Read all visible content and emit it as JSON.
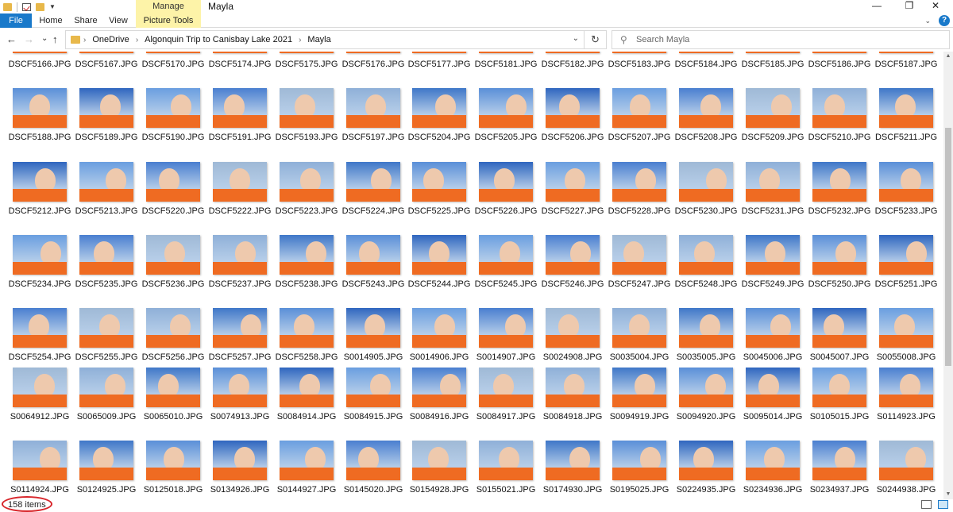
{
  "title_bar": {
    "manage_tab": "Manage",
    "window_title": "Mayla",
    "minimize": "—",
    "maximize": "❐",
    "close": "✕"
  },
  "ribbon": {
    "tabs": [
      "File",
      "Home",
      "Share",
      "View",
      "Picture Tools"
    ],
    "accent_color": "#1979ca",
    "tools_color": "#fdf3a8"
  },
  "nav": {
    "back": "←",
    "forward": "→",
    "recent": "⌄",
    "up": "↑",
    "breadcrumbs": [
      "OneDrive",
      "Algonquin Trip to Canisbay Lake 2021",
      "Mayla"
    ],
    "dropdown": "⌄",
    "refresh": "↻"
  },
  "search": {
    "placeholder": "Search Mayla"
  },
  "files": [
    [
      "DSCF5166.JPG",
      "DSCF5167.JPG",
      "DSCF5170.JPG",
      "DSCF5174.JPG",
      "DSCF5175.JPG",
      "DSCF5176.JPG",
      "DSCF5177.JPG",
      "DSCF5181.JPG",
      "DSCF5182.JPG",
      "DSCF5183.JPG",
      "DSCF5184.JPG",
      "DSCF5185.JPG",
      "DSCF5186.JPG",
      "DSCF5187.JPG"
    ],
    [
      "DSCF5188.JPG",
      "DSCF5189.JPG",
      "DSCF5190.JPG",
      "DSCF5191.JPG",
      "DSCF5193.JPG",
      "DSCF5197.JPG",
      "DSCF5204.JPG",
      "DSCF5205.JPG",
      "DSCF5206.JPG",
      "DSCF5207.JPG",
      "DSCF5208.JPG",
      "DSCF5209.JPG",
      "DSCF5210.JPG",
      "DSCF5211.JPG"
    ],
    [
      "DSCF5212.JPG",
      "DSCF5213.JPG",
      "DSCF5220.JPG",
      "DSCF5222.JPG",
      "DSCF5223.JPG",
      "DSCF5224.JPG",
      "DSCF5225.JPG",
      "DSCF5226.JPG",
      "DSCF5227.JPG",
      "DSCF5228.JPG",
      "DSCF5230.JPG",
      "DSCF5231.JPG",
      "DSCF5232.JPG",
      "DSCF5233.JPG"
    ],
    [
      "DSCF5234.JPG",
      "DSCF5235.JPG",
      "DSCF5236.JPG",
      "DSCF5237.JPG",
      "DSCF5238.JPG",
      "DSCF5243.JPG",
      "DSCF5244.JPG",
      "DSCF5245.JPG",
      "DSCF5246.JPG",
      "DSCF5247.JPG",
      "DSCF5248.JPG",
      "DSCF5249.JPG",
      "DSCF5250.JPG",
      "DSCF5251.JPG"
    ],
    [
      "DSCF5254.JPG",
      "DSCF5255.JPG",
      "DSCF5256.JPG",
      "DSCF5257.JPG",
      "DSCF5258.JPG",
      "S0014905.JPG",
      "S0014906.JPG",
      "S0014907.JPG",
      "S0024908.JPG",
      "S0035004.JPG",
      "S0035005.JPG",
      "S0045006.JPG",
      "S0045007.JPG",
      "S0055008.JPG"
    ],
    [
      "S0064912.JPG",
      "S0065009.JPG",
      "S0065010.JPG",
      "S0074913.JPG",
      "S0084914.JPG",
      "S0084915.JPG",
      "S0084916.JPG",
      "S0084917.JPG",
      "S0084918.JPG",
      "S0094919.JPG",
      "S0094920.JPG",
      "S0095014.JPG",
      "S0105015.JPG",
      "S0114923.JPG"
    ],
    [
      "S0114924.JPG",
      "S0124925.JPG",
      "S0125018.JPG",
      "S0134926.JPG",
      "S0144927.JPG",
      "S0145020.JPG",
      "S0154928.JPG",
      "S0155021.JPG",
      "S0174930.JPG",
      "S0195025.JPG",
      "S0224935.JPG",
      "S0234936.JPG",
      "S0234937.JPG",
      "S0244938.JPG"
    ]
  ],
  "status": {
    "item_count": "158 items",
    "highlight_color": "#d8262b"
  }
}
